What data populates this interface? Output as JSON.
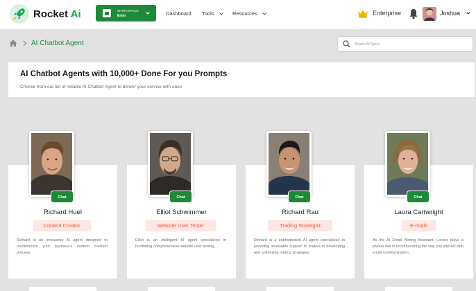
{
  "brand": {
    "name": "Rocket",
    "suffix": "Ai",
    "accent": "#1aa84b"
  },
  "workspace": {
    "label": "WORKSPACE",
    "name": "Emm",
    "bg": "#1e8a39"
  },
  "nav": {
    "dashboard": "Dashboard",
    "tools": "Tools",
    "resources": "Resources"
  },
  "account": {
    "plan": "Enterprise",
    "user": "Joshua"
  },
  "breadcrumb": {
    "title": "AI Chatbot Agent"
  },
  "search": {
    "placeholder": "Search AI Agent"
  },
  "hero": {
    "title": "AI Chatbot Agents with 10,000+ Done For you Prompts",
    "subtitle": "Choose from our list of reliable AI Chatbot Agent to deliver your service with ease"
  },
  "chat_label": "Chat",
  "agents": [
    {
      "name": "Richard Huel",
      "role": "Content Creator",
      "description": "Richard is an innovative AI agent designed to revolutionize your business's content creation process."
    },
    {
      "name": "Elliot Schwimmer",
      "role": "Website User Tester",
      "description": "Elliot is an intelligent AI agent specialized in facilitating comprehensive website user testing."
    },
    {
      "name": "Richard Rau",
      "role": "Trading Strategist",
      "description": "Richard is a sophisticated AI agent specialized in providing invaluable support to traders in developing and optimizing trading strategies."
    },
    {
      "name": "Laura Cartwright",
      "role": "E-mails",
      "description": "As the AI Email Writing Assistant, Lorenz plays a pivotal role in revolutionizing the way you interact with email communication."
    }
  ],
  "colors": {
    "primary_green": "#1e8a39",
    "role_bg": "#fde6e3",
    "role_text": "#f05b3f",
    "page_bg": "#e2e2e2"
  }
}
